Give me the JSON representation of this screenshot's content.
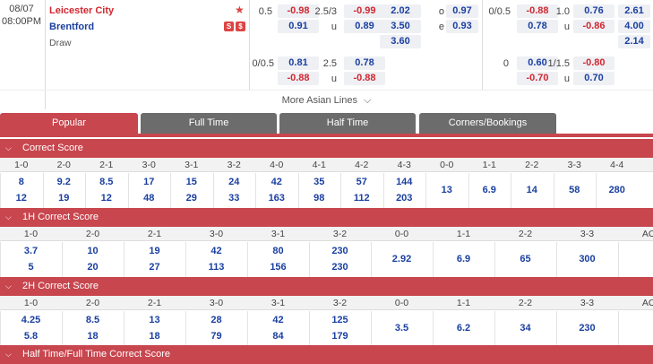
{
  "match": {
    "date": "08/07",
    "time": "08:00PM",
    "home": "Leicester City",
    "away": "Brentford",
    "draw": "Draw",
    "star_icon": "star-icon",
    "icon1": "S",
    "icon2": "$"
  },
  "markets": {
    "ah_line": "0.5",
    "ah_home": "-0.98",
    "ah_away": "0.91",
    "ou_line": "2.5/3",
    "ou_over": "-0.99",
    "ou_u": "u",
    "ou_under": "0.89",
    "x12_home": "2.02",
    "x12_away": "3.50",
    "x12_draw": "3.60",
    "oe_o": "o",
    "oe_o_val": "0.97",
    "oe_e": "e",
    "oe_e_val": "0.93",
    "h_ah_line": "0/0.5",
    "h_ah_home": "-0.88",
    "h_ah_away": "0.78",
    "h_ou_line": "1.0",
    "h_ou_over": "0.76",
    "h_ou_u": "u",
    "h_ou_under": "-0.86",
    "h_1x2_home": "2.61",
    "h_1x2_away": "4.00",
    "h_1x2_draw": "2.14",
    "ah2_line": "0/0.5",
    "ah2_home": "0.81",
    "ah2_away": "-0.88",
    "ou2_line": "2.5",
    "ou2_over": "0.78",
    "ou2_u": "u",
    "ou2_under": "-0.88",
    "h_ah2_line": "0",
    "h_ah2_home": "0.60",
    "h_ah2_away": "-0.70",
    "h_ou2_line": "1/1.5",
    "h_ou2_over": "-0.80",
    "h_ou2_u": "u",
    "h_ou2_under": "0.70"
  },
  "more_lines": "More Asian Lines",
  "tabs": [
    "Popular",
    "Full Time",
    "Half Time",
    "Corners/Bookings"
  ],
  "sections": {
    "correct_score": {
      "title": "Correct Score",
      "headers": [
        "1-0",
        "2-0",
        "2-1",
        "3-0",
        "3-1",
        "3-2",
        "4-0",
        "4-1",
        "4-2",
        "4-3",
        "0-0",
        "1-1",
        "2-2",
        "3-3",
        "4-4"
      ],
      "home": [
        "8",
        "9.2",
        "8.5",
        "17",
        "15",
        "24",
        "42",
        "35",
        "57",
        "144",
        "13",
        "6.9",
        "14",
        "58",
        "280"
      ],
      "away": [
        "12",
        "19",
        "12",
        "48",
        "29",
        "33",
        "163",
        "98",
        "112",
        "203"
      ]
    },
    "h1_correct_score": {
      "title": "1H Correct Score",
      "headers": [
        "1-0",
        "2-0",
        "2-1",
        "3-0",
        "3-1",
        "3-2",
        "0-0",
        "1-1",
        "2-2",
        "3-3",
        "AO"
      ],
      "home": [
        "3.7",
        "10",
        "19",
        "42",
        "80",
        "230",
        "2.92",
        "6.9",
        "65",
        "300",
        ""
      ],
      "away": [
        "5",
        "20",
        "27",
        "113",
        "156",
        "230"
      ]
    },
    "h2_correct_score": {
      "title": "2H Correct Score",
      "headers": [
        "1-0",
        "2-0",
        "2-1",
        "3-0",
        "3-1",
        "3-2",
        "0-0",
        "1-1",
        "2-2",
        "3-3",
        "AO"
      ],
      "home": [
        "4.25",
        "8.5",
        "13",
        "28",
        "42",
        "125",
        "3.5",
        "6.2",
        "34",
        "230",
        ""
      ],
      "away": [
        "5.8",
        "18",
        "18",
        "79",
        "84",
        "179"
      ]
    },
    "htft": {
      "title": "Half Time/Full Time Correct Score"
    }
  }
}
